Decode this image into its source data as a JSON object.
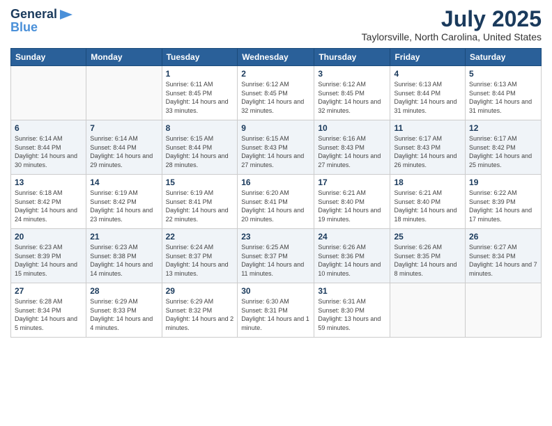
{
  "header": {
    "logo_line1": "General",
    "logo_line2": "Blue",
    "main_title": "July 2025",
    "sub_title": "Taylorsville, North Carolina, United States"
  },
  "calendar": {
    "headers": [
      "Sunday",
      "Monday",
      "Tuesday",
      "Wednesday",
      "Thursday",
      "Friday",
      "Saturday"
    ],
    "weeks": [
      [
        {
          "day": "",
          "sunrise": "",
          "sunset": "",
          "daylight": "",
          "empty": true
        },
        {
          "day": "",
          "sunrise": "",
          "sunset": "",
          "daylight": "",
          "empty": true
        },
        {
          "day": "1",
          "sunrise": "Sunrise: 6:11 AM",
          "sunset": "Sunset: 8:45 PM",
          "daylight": "Daylight: 14 hours and 33 minutes."
        },
        {
          "day": "2",
          "sunrise": "Sunrise: 6:12 AM",
          "sunset": "Sunset: 8:45 PM",
          "daylight": "Daylight: 14 hours and 32 minutes."
        },
        {
          "day": "3",
          "sunrise": "Sunrise: 6:12 AM",
          "sunset": "Sunset: 8:45 PM",
          "daylight": "Daylight: 14 hours and 32 minutes."
        },
        {
          "day": "4",
          "sunrise": "Sunrise: 6:13 AM",
          "sunset": "Sunset: 8:44 PM",
          "daylight": "Daylight: 14 hours and 31 minutes."
        },
        {
          "day": "5",
          "sunrise": "Sunrise: 6:13 AM",
          "sunset": "Sunset: 8:44 PM",
          "daylight": "Daylight: 14 hours and 31 minutes."
        }
      ],
      [
        {
          "day": "6",
          "sunrise": "Sunrise: 6:14 AM",
          "sunset": "Sunset: 8:44 PM",
          "daylight": "Daylight: 14 hours and 30 minutes."
        },
        {
          "day": "7",
          "sunrise": "Sunrise: 6:14 AM",
          "sunset": "Sunset: 8:44 PM",
          "daylight": "Daylight: 14 hours and 29 minutes."
        },
        {
          "day": "8",
          "sunrise": "Sunrise: 6:15 AM",
          "sunset": "Sunset: 8:44 PM",
          "daylight": "Daylight: 14 hours and 28 minutes."
        },
        {
          "day": "9",
          "sunrise": "Sunrise: 6:15 AM",
          "sunset": "Sunset: 8:43 PM",
          "daylight": "Daylight: 14 hours and 27 minutes."
        },
        {
          "day": "10",
          "sunrise": "Sunrise: 6:16 AM",
          "sunset": "Sunset: 8:43 PM",
          "daylight": "Daylight: 14 hours and 27 minutes."
        },
        {
          "day": "11",
          "sunrise": "Sunrise: 6:17 AM",
          "sunset": "Sunset: 8:43 PM",
          "daylight": "Daylight: 14 hours and 26 minutes."
        },
        {
          "day": "12",
          "sunrise": "Sunrise: 6:17 AM",
          "sunset": "Sunset: 8:42 PM",
          "daylight": "Daylight: 14 hours and 25 minutes."
        }
      ],
      [
        {
          "day": "13",
          "sunrise": "Sunrise: 6:18 AM",
          "sunset": "Sunset: 8:42 PM",
          "daylight": "Daylight: 14 hours and 24 minutes."
        },
        {
          "day": "14",
          "sunrise": "Sunrise: 6:19 AM",
          "sunset": "Sunset: 8:42 PM",
          "daylight": "Daylight: 14 hours and 23 minutes."
        },
        {
          "day": "15",
          "sunrise": "Sunrise: 6:19 AM",
          "sunset": "Sunset: 8:41 PM",
          "daylight": "Daylight: 14 hours and 22 minutes."
        },
        {
          "day": "16",
          "sunrise": "Sunrise: 6:20 AM",
          "sunset": "Sunset: 8:41 PM",
          "daylight": "Daylight: 14 hours and 20 minutes."
        },
        {
          "day": "17",
          "sunrise": "Sunrise: 6:21 AM",
          "sunset": "Sunset: 8:40 PM",
          "daylight": "Daylight: 14 hours and 19 minutes."
        },
        {
          "day": "18",
          "sunrise": "Sunrise: 6:21 AM",
          "sunset": "Sunset: 8:40 PM",
          "daylight": "Daylight: 14 hours and 18 minutes."
        },
        {
          "day": "19",
          "sunrise": "Sunrise: 6:22 AM",
          "sunset": "Sunset: 8:39 PM",
          "daylight": "Daylight: 14 hours and 17 minutes."
        }
      ],
      [
        {
          "day": "20",
          "sunrise": "Sunrise: 6:23 AM",
          "sunset": "Sunset: 8:39 PM",
          "daylight": "Daylight: 14 hours and 15 minutes."
        },
        {
          "day": "21",
          "sunrise": "Sunrise: 6:23 AM",
          "sunset": "Sunset: 8:38 PM",
          "daylight": "Daylight: 14 hours and 14 minutes."
        },
        {
          "day": "22",
          "sunrise": "Sunrise: 6:24 AM",
          "sunset": "Sunset: 8:37 PM",
          "daylight": "Daylight: 14 hours and 13 minutes."
        },
        {
          "day": "23",
          "sunrise": "Sunrise: 6:25 AM",
          "sunset": "Sunset: 8:37 PM",
          "daylight": "Daylight: 14 hours and 11 minutes."
        },
        {
          "day": "24",
          "sunrise": "Sunrise: 6:26 AM",
          "sunset": "Sunset: 8:36 PM",
          "daylight": "Daylight: 14 hours and 10 minutes."
        },
        {
          "day": "25",
          "sunrise": "Sunrise: 6:26 AM",
          "sunset": "Sunset: 8:35 PM",
          "daylight": "Daylight: 14 hours and 8 minutes."
        },
        {
          "day": "26",
          "sunrise": "Sunrise: 6:27 AM",
          "sunset": "Sunset: 8:34 PM",
          "daylight": "Daylight: 14 hours and 7 minutes."
        }
      ],
      [
        {
          "day": "27",
          "sunrise": "Sunrise: 6:28 AM",
          "sunset": "Sunset: 8:34 PM",
          "daylight": "Daylight: 14 hours and 5 minutes."
        },
        {
          "day": "28",
          "sunrise": "Sunrise: 6:29 AM",
          "sunset": "Sunset: 8:33 PM",
          "daylight": "Daylight: 14 hours and 4 minutes."
        },
        {
          "day": "29",
          "sunrise": "Sunrise: 6:29 AM",
          "sunset": "Sunset: 8:32 PM",
          "daylight": "Daylight: 14 hours and 2 minutes."
        },
        {
          "day": "30",
          "sunrise": "Sunrise: 6:30 AM",
          "sunset": "Sunset: 8:31 PM",
          "daylight": "Daylight: 14 hours and 1 minute."
        },
        {
          "day": "31",
          "sunrise": "Sunrise: 6:31 AM",
          "sunset": "Sunset: 8:30 PM",
          "daylight": "Daylight: 13 hours and 59 minutes."
        },
        {
          "day": "",
          "sunrise": "",
          "sunset": "",
          "daylight": "",
          "empty": true
        },
        {
          "day": "",
          "sunrise": "",
          "sunset": "",
          "daylight": "",
          "empty": true
        }
      ]
    ]
  }
}
